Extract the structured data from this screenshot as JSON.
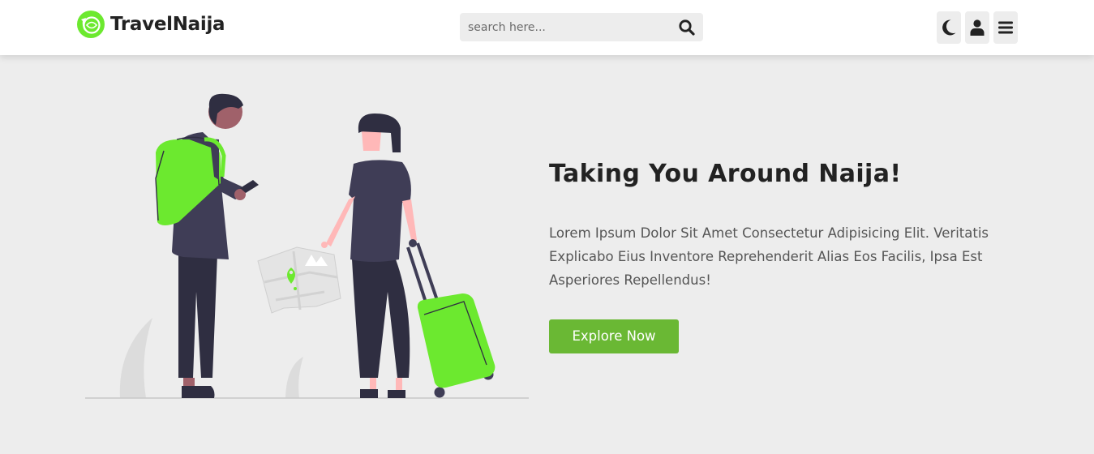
{
  "header": {
    "brand": "TravelNaija",
    "search": {
      "placeholder": "search here...",
      "value": ""
    },
    "icons": [
      "moon-icon",
      "user-icon",
      "menu-icon"
    ]
  },
  "hero": {
    "title": "Taking You Around Naija!",
    "text": "Lorem Ipsum Dolor Sit Amet Consectetur Adipisicing Elit. Veritatis Explicabo Eius Inventore Reprehenderit Alias Eos Facilis, Ipsa Est Asperiores Repellendus!",
    "button_label": "Explore Now"
  },
  "colors": {
    "accent": "#6ab834",
    "illustration_green": "#6ce92f",
    "header_bg": "#ffffff",
    "page_bg": "#ededed",
    "dark_figure": "#3f3d56"
  }
}
